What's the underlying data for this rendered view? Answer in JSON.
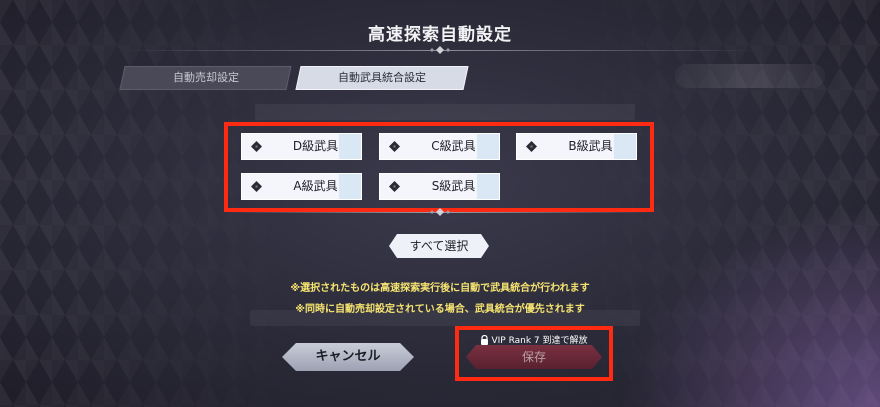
{
  "header": {
    "title": "高速探索自動設定"
  },
  "tabs": [
    {
      "label": "自動売却設定",
      "active": false
    },
    {
      "label": "自動武具統合設定",
      "active": true
    }
  ],
  "grades": [
    {
      "label": "D級武具",
      "icon": "weapon-icon"
    },
    {
      "label": "C級武具",
      "icon": "weapon-icon"
    },
    {
      "label": "B級武具",
      "icon": "weapon-icon"
    },
    {
      "label": "A級武具",
      "icon": "weapon-icon"
    },
    {
      "label": "S級武具",
      "icon": "weapon-icon"
    }
  ],
  "select_all_label": "すべて選択",
  "notices": [
    "※選択されたものは高速探索実行後に自動で武具統合が行われます",
    "※同時に自動売却設定されている場合、武具統合が優先されます"
  ],
  "buttons": {
    "cancel_label": "キャンセル",
    "save_label": "保存",
    "save_lock_text": "VIP Rank 7 到達で解放",
    "save_enabled": false
  },
  "colors": {
    "highlight_border": "#ff2a12",
    "notice_text": "#f6e470",
    "save_button": "#6a2636"
  }
}
